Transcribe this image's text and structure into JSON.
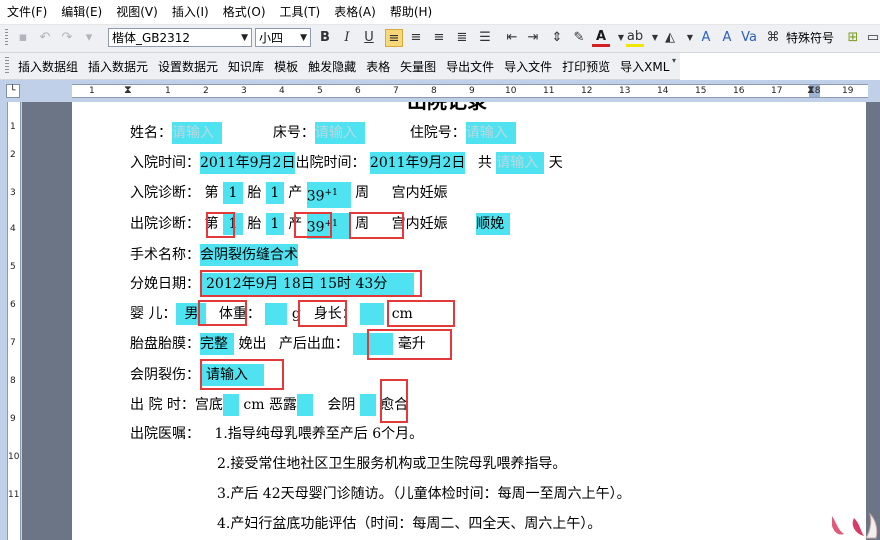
{
  "menu": [
    "文件(F)",
    "编辑(E)",
    "视图(V)",
    "插入(I)",
    "格式(O)",
    "工具(T)",
    "表格(A)",
    "帮助(H)"
  ],
  "font": {
    "name": "楷体_GB2312",
    "size": "小四"
  },
  "toolbar1_right_label": "特殊符号",
  "data_toolbar": [
    "插入数据组",
    "插入数据元",
    "设置数据元",
    "知识库",
    "模板",
    "触发隐藏",
    "表格",
    "矢量图",
    "导出文件",
    "导入文件",
    "打印预览",
    "导入XML"
  ],
  "ruler": {
    "h_numbers": [
      "1",
      "1",
      "2",
      "3",
      "4",
      "5",
      "6",
      "7",
      "8",
      "9",
      "10",
      "11",
      "12",
      "13",
      "14",
      "15",
      "16",
      "17",
      "18",
      "19"
    ],
    "v_numbers": [
      "1",
      "2",
      "3",
      "4",
      "5",
      "6",
      "7",
      "8",
      "9",
      "10",
      "11"
    ]
  },
  "doc": {
    "title_partial": "出院记录",
    "row1": {
      "name_label": "姓名：",
      "name_value": "请输入",
      "bed_label": "床号：",
      "bed_value": "请输入",
      "admission_no_label": "住院号：",
      "admission_no_value": "请输入"
    },
    "row2": {
      "admit_label": "入院时间：",
      "admit_value": "2011年9月2日",
      "discharge_label": "出院时间：",
      "discharge_value": "2011年9月2日",
      "total_prefix": "共",
      "total_value": "请输入",
      "total_unit": "天"
    },
    "row3": {
      "label": "入院诊断：",
      "di": "第",
      "tai_n": "1",
      "tai": "胎",
      "chan_n": "1",
      "chan": "产",
      "weeks": "39",
      "weeks_sup": "+1",
      "zhou": "周",
      "dx": "宫内妊娠"
    },
    "row4": {
      "label": "出院诊断：",
      "di": "第",
      "tai_n": "1",
      "tai": "胎",
      "chan_n": "1",
      "chan": "产",
      "weeks": "39",
      "weeks_sup": "+1",
      "zhou": "周",
      "dx": "宫内妊娠",
      "delivery": "顺娩"
    },
    "row5": {
      "label": "手术名称：",
      "value": "会阴裂伤缝合术"
    },
    "row6": {
      "label": "分娩日期：",
      "value": "2012年9月 18日 15时 43分"
    },
    "row7": {
      "baby_label": "婴    儿：",
      "baby_value": "男",
      "weight_label": "体重：",
      "weight_unit": "g",
      "height_label": "身长：",
      "height_unit": "cm"
    },
    "row8": {
      "label": "胎盘胎膜：",
      "value": "完整",
      "after": "娩出",
      "bleed_label": "产后出血：",
      "bleed_unit": "毫升"
    },
    "row9": {
      "label": "会阴裂伤：",
      "value": "请输入"
    },
    "row10": {
      "label": "出 院 时：",
      "uterus": "宫底",
      "cm": "cm",
      "lochia": "恶露",
      "perineum": "会阴",
      "heal": "愈合"
    },
    "row11": {
      "label": "出院医嘱："
    },
    "advice": [
      "1.指导纯母乳喂养至产后 6个月。",
      "2.接受常住地社区卫生服务机构或卫生院母乳喂养指导。",
      "3.产后 42天母婴门诊随访。（儿童体检时间：每周一至周六上午）。",
      "4.产妇行盆底功能评估（时间：每周二、四全天、周六上午）。"
    ]
  }
}
